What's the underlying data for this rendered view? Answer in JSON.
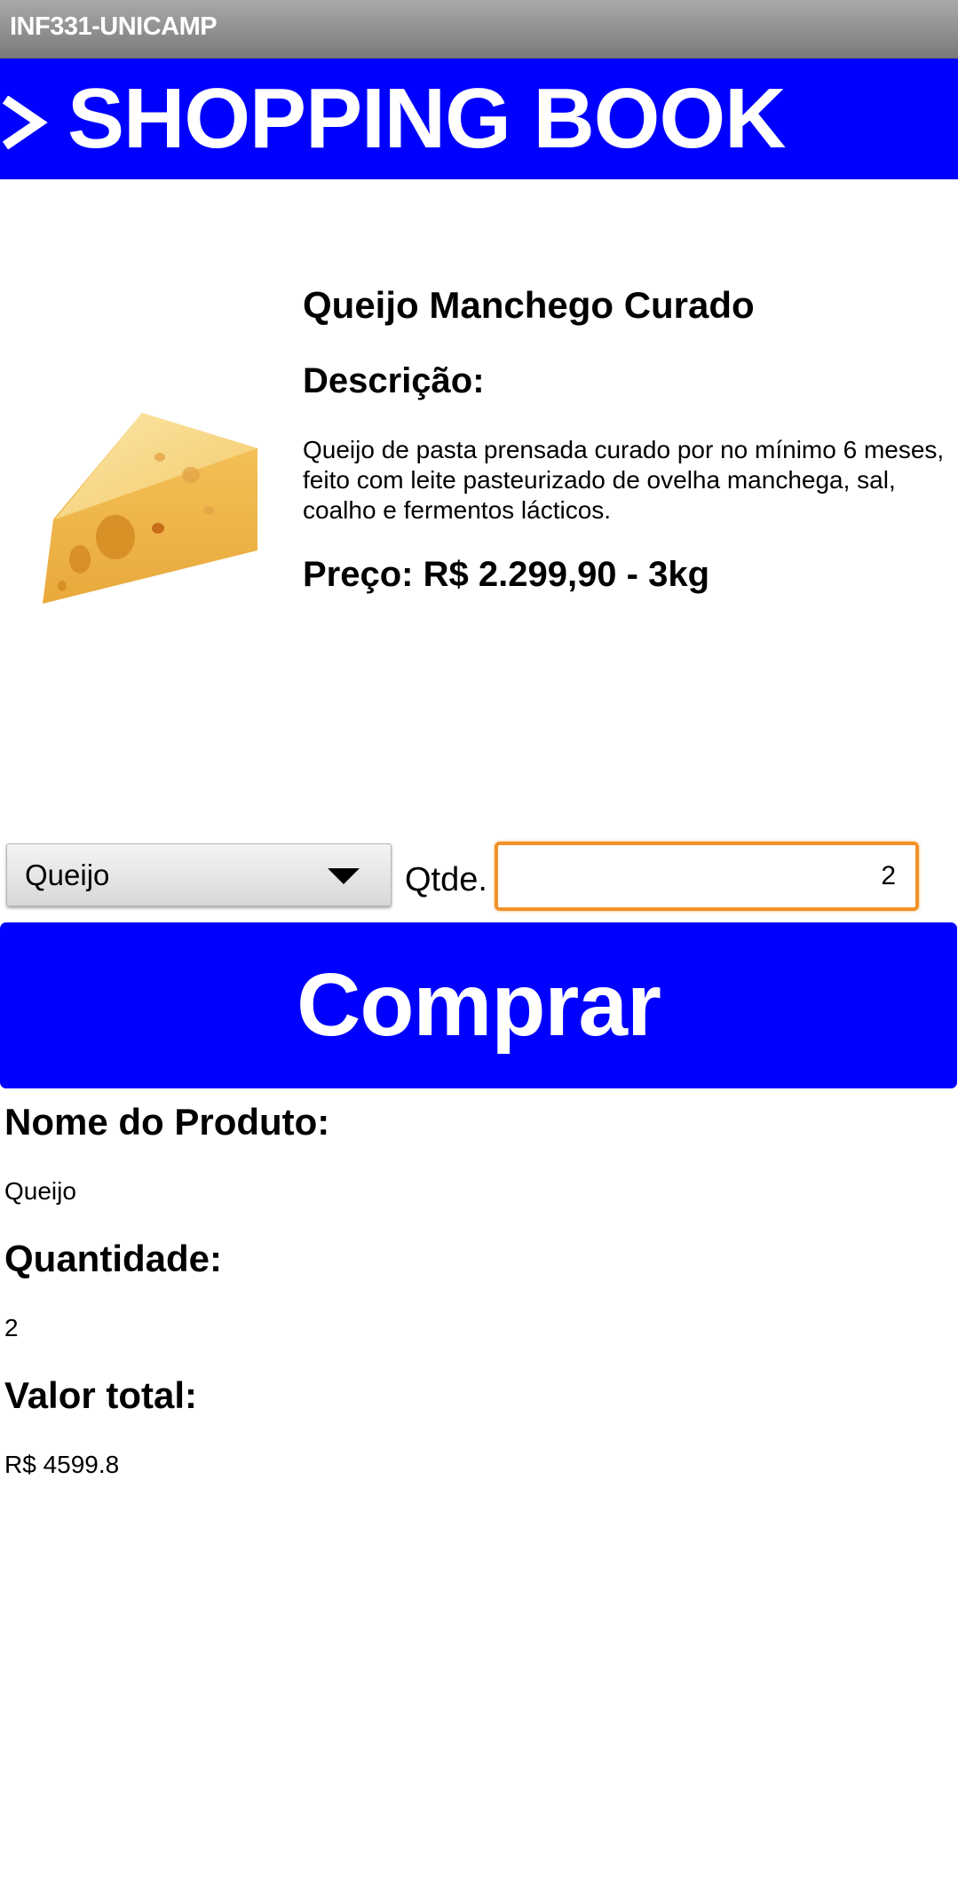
{
  "app_bar": {
    "title": "INF331-UNICAMP"
  },
  "banner": {
    "icon": "chevron-right-icon",
    "title": "SHOPPING BOOK",
    "background_color": "#0000ff"
  },
  "product": {
    "image_icon": "cheese-wedge-image",
    "name": "Queijo Manchego Curado",
    "description_heading": "Descrição:",
    "description": "Queijo de pasta prensada curado por no mínimo 6 meses, feito com leite pasteurizado de ovelha manchega, sal, coalho e fermentos lácticos.",
    "price": "Preço: R$ 2.299,90 - 3kg"
  },
  "order_form": {
    "product_select_value": "Queijo",
    "quantity_label": "Qtde.",
    "quantity_value": "2",
    "buy_button_label": "Comprar",
    "accent_color": "#f0922a"
  },
  "summary": {
    "product_name_heading": "Nome do Produto:",
    "product_name_value": "Queijo",
    "quantity_heading": "Quantidade:",
    "quantity_value": "2",
    "total_heading": "Valor total:",
    "total_value": "R$ 4599.8"
  }
}
